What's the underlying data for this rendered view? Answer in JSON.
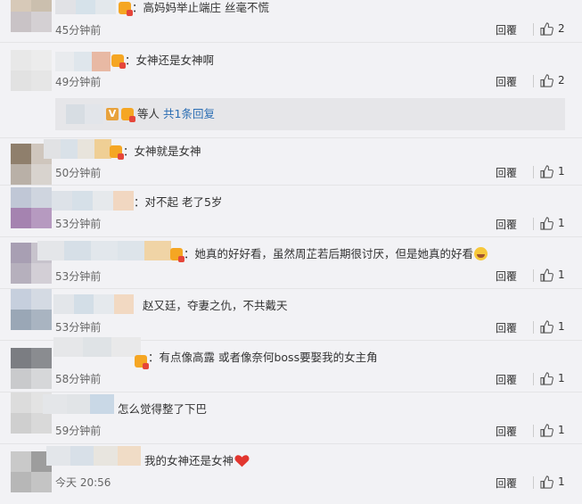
{
  "ui": {
    "reply_label": "回覆"
  },
  "comments": [
    {
      "text": "：高妈妈举止端庄 丝毫不慌",
      "time": "45分钟前",
      "likes": "2"
    },
    {
      "text": "：女神还是女神啊",
      "time": "49分钟前",
      "likes": "2"
    },
    {
      "text": "：女神就是女神",
      "time": "50分钟前",
      "likes": "1"
    },
    {
      "text": "：对不起 老了5岁",
      "time": "53分钟前",
      "likes": "1"
    },
    {
      "text": "：她真的好好看，虽然周芷若后期很讨厌，但是她真的好看",
      "time": "53分钟前",
      "likes": "1"
    },
    {
      "text": "赵又廷，夺妻之仇，不共戴天",
      "time": "53分钟前",
      "likes": "1"
    },
    {
      "text": "：有点像高露 或者像奈何boss要娶我的女主角",
      "time": "58分钟前",
      "likes": "1"
    },
    {
      "text": "怎么觉得整了下巴",
      "time": "59分钟前",
      "likes": "1"
    },
    {
      "text": "我的女神还是女神",
      "time": "今天 20:56",
      "likes": "1"
    }
  ],
  "sub_reply": {
    "prefix": "等人",
    "link": "共1条回复"
  },
  "colors": {
    "link": "#2a6db3",
    "background": "#f2f2f5"
  }
}
